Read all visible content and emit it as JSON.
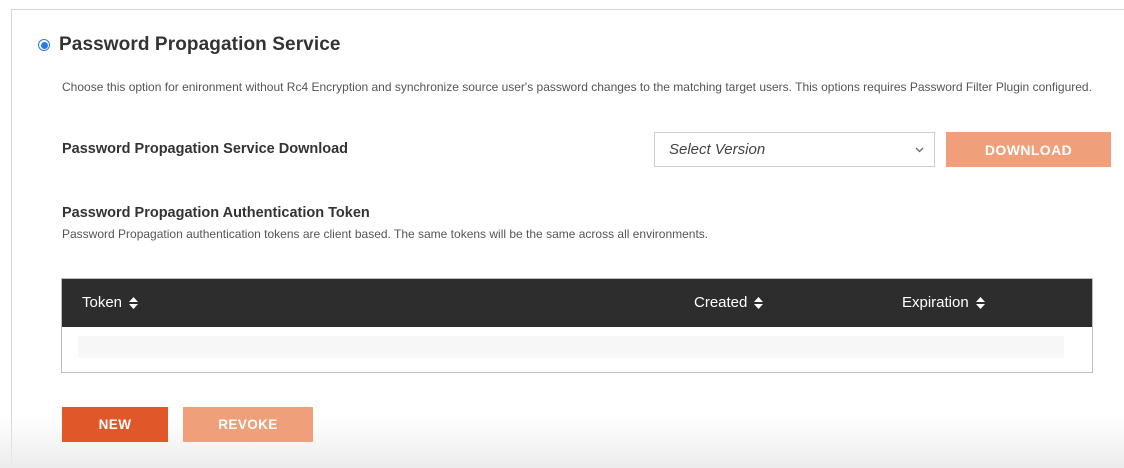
{
  "option": {
    "title": "Password Propagation Service",
    "selected": true,
    "description": "Choose this option for enironment without Rc4 Encryption and synchronize source user's password changes to the matching target users. This options requires Password Filter Plugin configured."
  },
  "download": {
    "label": "Password Propagation Service Download",
    "select_value": "Select Version",
    "button_label": "DOWNLOAD"
  },
  "token_section": {
    "title": "Password Propagation Authentication Token",
    "description": "Password Propagation authentication tokens are client based. The same tokens will be the same across all environments.",
    "columns": [
      "Token",
      "Created",
      "Expiration"
    ],
    "rows": []
  },
  "actions": {
    "new_label": "NEW",
    "revoke_label": "REVOKE"
  },
  "colors": {
    "primary_button": "#e0572a",
    "disabled_button": "#ef9f79",
    "table_header": "#2d2d2d",
    "radio": "#2a7ae2"
  }
}
